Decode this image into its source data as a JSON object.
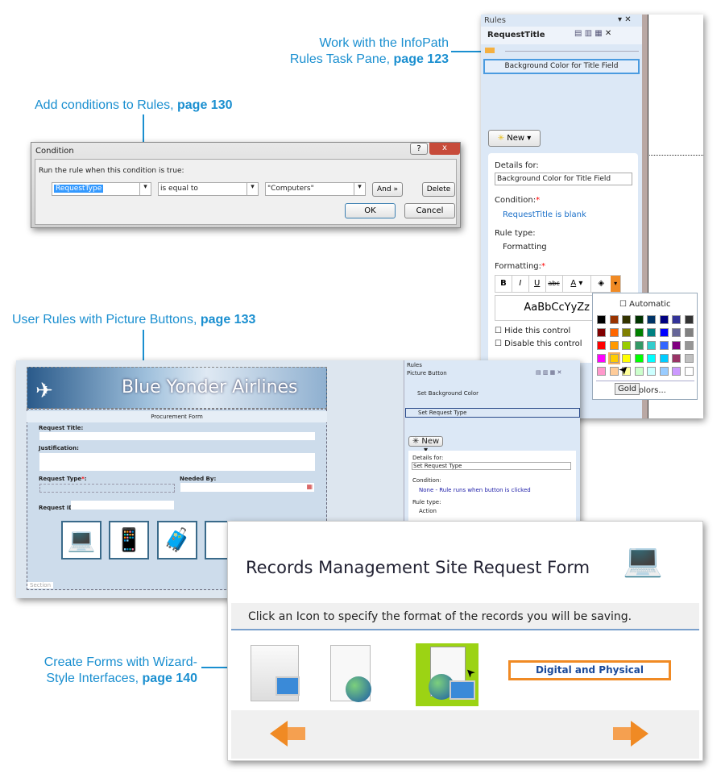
{
  "callouts": {
    "rules_pane": {
      "line1": "Work with the InfoPath",
      "line2": "Rules Task Pane, ",
      "page": "page 123"
    },
    "conditions": {
      "text": "Add conditions to Rules, ",
      "page": "page 130"
    },
    "picture_buttons": {
      "text": "User Rules with Picture Buttons, ",
      "page": "page 133"
    },
    "wizard": {
      "line1": "Create Forms with Wizard-",
      "line2": "Style Interfaces, ",
      "page": "page 140"
    }
  },
  "rules_pane": {
    "title": "Rules",
    "control": "RequestTitle",
    "rule": "Background Color for Title Field",
    "new_label": "New",
    "details_label": "Details for:",
    "details_value": "Background Color for Title Field",
    "condition_label": "Condition:",
    "condition_value": "RequestTitle is blank",
    "rule_type_label": "Rule type:",
    "rule_type_value": "Formatting",
    "formatting_label": "Formatting:",
    "preview": "AaBbCcYyZz",
    "hide": "Hide this control",
    "disable": "Disable this control",
    "palette": {
      "automatic": "Automatic",
      "more": "Colors...",
      "tooltip": "Gold",
      "colors": [
        "#000000",
        "#993300",
        "#333300",
        "#003300",
        "#003366",
        "#000080",
        "#333399",
        "#333333",
        "#800000",
        "#ff6600",
        "#808000",
        "#008000",
        "#008080",
        "#0000ff",
        "#666699",
        "#808080",
        "#ff0000",
        "#ff9900",
        "#99cc00",
        "#339966",
        "#33cccc",
        "#3366ff",
        "#800080",
        "#969696",
        "#ff00ff",
        "#ffcc00",
        "#ffff00",
        "#00ff00",
        "#00ffff",
        "#00ccff",
        "#993366",
        "#c0c0c0",
        "#ff99cc",
        "#ffcc99",
        "#ffff99",
        "#ccffcc",
        "#ccffff",
        "#99ccff",
        "#cc99ff",
        "#ffffff"
      ],
      "selected": "#ffcc00"
    }
  },
  "condition_dialog": {
    "title": "Condition",
    "prompt": "Run the rule when this condition is true:",
    "field": "RequestType",
    "operator": "is equal to",
    "value": "\"Computers\"",
    "and": "And »",
    "delete": "Delete",
    "ok": "OK",
    "cancel": "Cancel",
    "help": "?",
    "close": "x"
  },
  "infopath_form": {
    "banner": "Blue Yonder Airlines",
    "section_title": "Procurement Form",
    "request_title": "Request Title:",
    "justification": "Justification:",
    "request_type": "Request Type",
    "required": "*",
    "needed_by": "Needed By:",
    "request_id": "Request ID:",
    "section": "Section",
    "pane": {
      "title": "Rules",
      "control": "Picture Button",
      "rule1": "Set Background Color",
      "rule2": "Set Request Type",
      "new_label": "New",
      "details_label": "Details for:",
      "details_value": "Set Request Type",
      "condition_label": "Condition:",
      "condition_value": "None - Rule runs when button is clicked",
      "rule_type_label": "Rule type:",
      "rule_type_value": "Action"
    }
  },
  "records_form": {
    "title": "Records Management Site Request Form",
    "instruction": "Click an Icon to specify the format of the records you will be saving.",
    "option": "Digital and Physical"
  },
  "colors": {
    "accent": "#1a8fd0",
    "orange": "#f08a24",
    "pane_bg": "#dce8f6"
  }
}
